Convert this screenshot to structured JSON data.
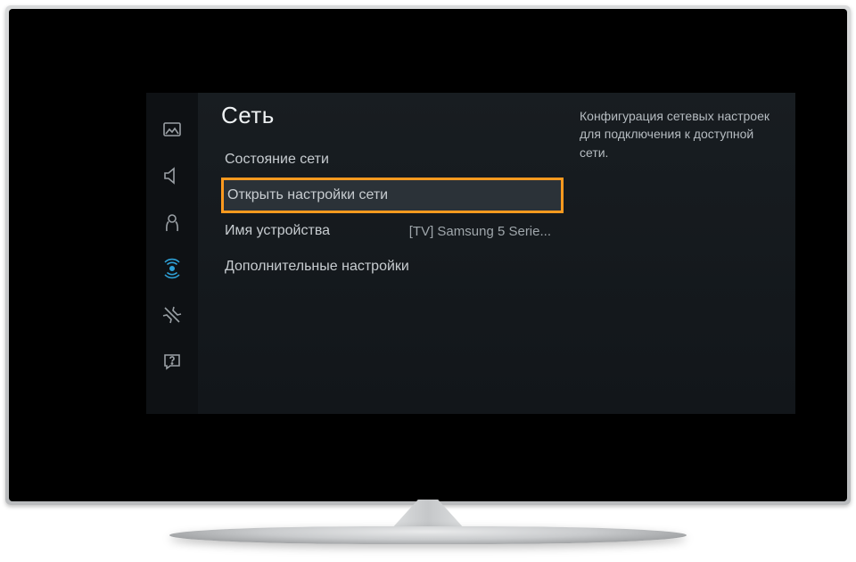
{
  "section_title": "Сеть",
  "description": "Конфигурация сетевых настроек для подключения к доступной сети.",
  "menu": {
    "network_status": {
      "label": "Состояние сети"
    },
    "open_network_settings": {
      "label": "Открыть настройки сети"
    },
    "device_name": {
      "label": "Имя устройства",
      "value": "[TV] Samsung 5 Serie..."
    },
    "advanced": {
      "label": "Дополнительные настройки"
    }
  },
  "sidebar_icons": {
    "picture": "picture-icon",
    "sound": "sound-icon",
    "broadcast": "broadcast-icon",
    "network": "network-icon",
    "system": "system-icon",
    "support": "support-icon"
  }
}
